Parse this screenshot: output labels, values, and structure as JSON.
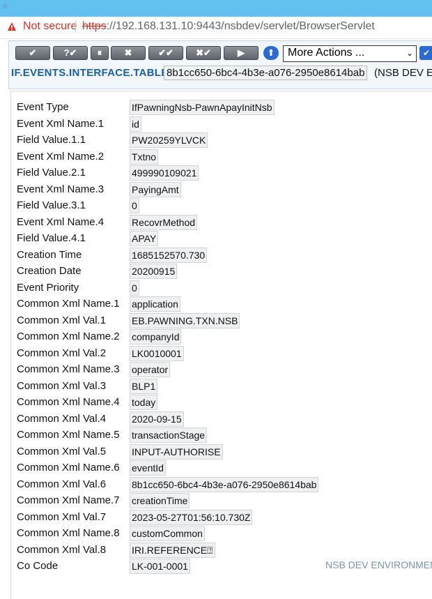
{
  "browser": {
    "security_text": "Not secure",
    "url_scheme": "https",
    "url_rest": "://192.168.131.10:9443/nsbdev/servlet/BrowserServlet"
  },
  "toolbar": {
    "buttons": [
      {
        "label": "✔",
        "name": "commit-button"
      },
      {
        "label": "?✔",
        "name": "validate-button"
      },
      {
        "label": "⏸",
        "name": "hold-button"
      },
      {
        "label": "✖",
        "name": "delete-button"
      },
      {
        "label": "✔✔",
        "name": "authorise-button"
      },
      {
        "label": "✖✔",
        "name": "reverse-button"
      },
      {
        "label": "▶",
        "name": "view-button"
      }
    ],
    "more_actions": "More Actions ..."
  },
  "header": {
    "table": "IF.EVENTS.INTERFACE.TABLE",
    "record_id": "8b1cc650-6bc4-4b3e-a076-2950e8614bab",
    "environment": "(NSB DEV EN"
  },
  "fields": [
    {
      "label": "Event Type",
      "value": "IfPawningNsb-PawnApayInitNsb"
    },
    {
      "label": "Event Xml Name.1",
      "value": "id"
    },
    {
      "label": "Field Value.1.1",
      "value": "PW20259YLVCK"
    },
    {
      "label": "Event Xml Name.2",
      "value": "Txtno"
    },
    {
      "label": "Field Value.2.1",
      "value": "499990109021"
    },
    {
      "label": "Event Xml Name.3",
      "value": "PayingAmt"
    },
    {
      "label": "Field Value.3.1",
      "value": "0"
    },
    {
      "label": "Event Xml Name.4",
      "value": "RecovrMethod"
    },
    {
      "label": "Field Value.4.1",
      "value": "APAY"
    },
    {
      "label": "Creation Time",
      "value": "1685152570.730"
    },
    {
      "label": "Creation Date",
      "value": "20200915"
    },
    {
      "label": "Event Priority",
      "value": "0"
    },
    {
      "label": "Common Xml Name.1",
      "value": "application"
    },
    {
      "label": "Common Xml Val.1",
      "value": "EB.PAWNING.TXN.NSB"
    },
    {
      "label": "Common Xml Name.2",
      "value": "companyId"
    },
    {
      "label": "Common Xml Val.2",
      "value": "LK0010001"
    },
    {
      "label": "Common Xml Name.3",
      "value": "operator"
    },
    {
      "label": "Common Xml Val.3",
      "value": "BLP1"
    },
    {
      "label": "Common Xml Name.4",
      "value": "today"
    },
    {
      "label": "Common Xml Val.4",
      "value": "2020-09-15"
    },
    {
      "label": "Common Xml Name.5",
      "value": "transactionStage"
    },
    {
      "label": "Common Xml Val.5",
      "value": "INPUT-AUTHORISE"
    },
    {
      "label": "Common Xml Name.6",
      "value": "eventId"
    },
    {
      "label": "Common Xml Val.6",
      "value": "8b1cc650-6bc4-4b3e-a076-2950e8614bab"
    },
    {
      "label": "Common Xml Name.7",
      "value": "creationTime"
    },
    {
      "label": "Common Xml Val.7",
      "value": "2023-05-27T01:56:10.730Z"
    },
    {
      "label": "Common Xml Name.8",
      "value": "customCommon"
    },
    {
      "label": "Common Xml Val.8",
      "value": "IRI.REFERENCE⍰"
    },
    {
      "label": "Co Code",
      "value": "LK-001-0001"
    }
  ],
  "footer": {
    "environment": "NSB DEV ENVIRONMEN"
  }
}
